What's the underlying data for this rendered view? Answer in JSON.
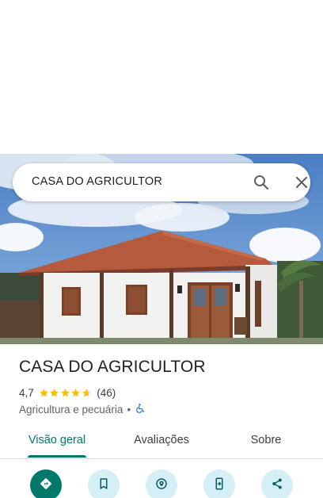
{
  "search": {
    "query": "CASA DO AGRICULTOR",
    "search_icon": "search-icon",
    "clear_icon": "close-icon"
  },
  "place": {
    "name": "CASA DO AGRICULTOR",
    "rating": "4,7",
    "rating_stars": 4.7,
    "review_count": "(46)",
    "category": "Agricultura e pecuária",
    "separator": "•",
    "accessibility_icon": "wheelchair-icon"
  },
  "tabs": [
    {
      "label": "Visão geral",
      "active": true
    },
    {
      "label": "Avaliações",
      "active": false
    },
    {
      "label": "Sobre",
      "active": false
    }
  ],
  "actions": [
    {
      "icon": "directions-icon",
      "primary": true
    },
    {
      "icon": "bookmark-icon",
      "primary": false
    },
    {
      "icon": "nearby-icon",
      "primary": false
    },
    {
      "icon": "send-to-phone-icon",
      "primary": false
    },
    {
      "icon": "share-icon",
      "primary": false
    }
  ],
  "colors": {
    "accent": "#00796b",
    "action_bg": "#d4f0f6",
    "star": "#fbbc04",
    "a11y": "#1a73e8"
  }
}
